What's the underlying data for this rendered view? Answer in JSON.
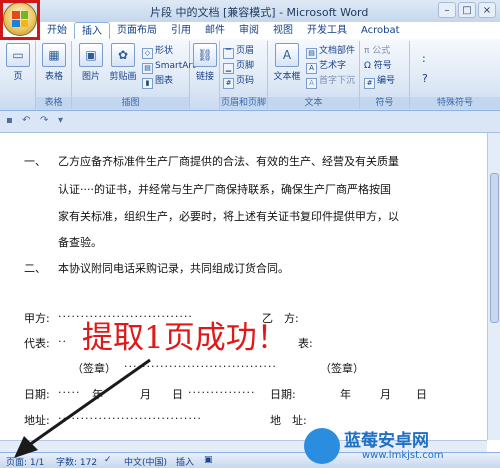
{
  "window": {
    "title": "片段 中的文档 [兼容模式] - Microsoft Word",
    "controls": [
      "–",
      "□",
      "×"
    ]
  },
  "tabs": [
    "开始",
    "插入",
    "页面布局",
    "引用",
    "邮件",
    "审阅",
    "视图",
    "开发工具",
    "Acrobat"
  ],
  "active_tab": "插入",
  "ribbon": {
    "page_label": "页",
    "table_label": "表格",
    "picture": "图片",
    "clipart": "剪贴画",
    "shapes": "形状",
    "smartart": "SmartArt",
    "chart": "图表",
    "link": "链接",
    "header": "页眉",
    "footer": "页脚",
    "page_number": "页码",
    "textbox": "文本框",
    "doc_parts": "文档部件",
    "wordart": "艺术字",
    "dropcap": "首字下沉",
    "formula": "π 公式",
    "symbol": "Ω 符号",
    "numbering": "编号",
    "sym1": ":",
    "sym2": "?",
    "groups": {
      "tables": "表格",
      "illustrations": "插图",
      "header_footer": "页眉和页脚",
      "text": "文本",
      "symbols": "符号",
      "special": "特殊符号"
    }
  },
  "document": {
    "line1_num": "一、",
    "line1": "乙方应备齐标准件生产厂商提供的合法、有效的生产、经营及有关质量",
    "line2": "认证····的证书，并经常与生产厂商保持联系，确保生产厂商严格按国",
    "line3": "家有关标准，组织生产，必要时，将上述有关证书复印件提供甲方，以",
    "line4": "备查验。",
    "line5_num": "二、",
    "line5": "本协议附同电话采购记录，共同组成订货合同。",
    "party_a": "甲方:",
    "party_b": "乙　方:",
    "rep_a": "代表:",
    "rep_b": "表:",
    "sign_a": "（签章）",
    "sign_b": "（签章）",
    "date_a": "日期:",
    "date_b": "日期:",
    "year": "年",
    "month": "月",
    "day": "日",
    "addr_a": "地址:",
    "addr_b": "地　址:"
  },
  "overlay_text": "提取1页成功！",
  "status": {
    "page": "页面: 1/1",
    "words": "字数: 172",
    "lang": "中文(中国)",
    "mode": "插入"
  },
  "watermark": {
    "brand": "蓝莓安卓网",
    "url": "www.lmkjst.com"
  }
}
